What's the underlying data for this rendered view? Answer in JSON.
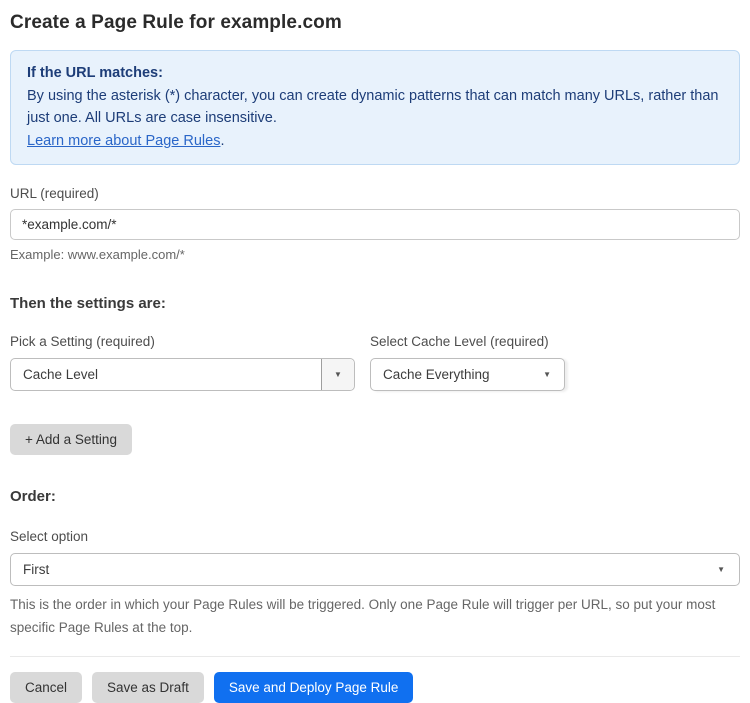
{
  "page": {
    "title": "Create a Page Rule for example.com"
  },
  "info_box": {
    "heading": "If the URL matches:",
    "body": "By using the asterisk (*) character, you can create dynamic patterns that can match many URLs, rather than just one. All URLs are case insensitive.",
    "link_label": "Learn more about Page Rules",
    "link_suffix": "."
  },
  "url_field": {
    "label": "URL (required)",
    "value": "*example.com/*",
    "helper": "Example: www.example.com/*"
  },
  "settings": {
    "heading": "Then the settings are:",
    "setting_picker": {
      "label": "Pick a Setting (required)",
      "value": "Cache Level"
    },
    "cache_level_picker": {
      "label": "Select Cache Level (required)",
      "value": "Cache Everything"
    },
    "add_setting_label": "+ Add a Setting"
  },
  "order": {
    "heading": "Order:",
    "label": "Select option",
    "value": "First",
    "helper": "This is the order in which your Page Rules will be triggered. Only one Page Rule will trigger per URL, so put your most specific Page Rules at the top."
  },
  "footer": {
    "cancel_label": "Cancel",
    "save_draft_label": "Save as Draft",
    "save_deploy_label": "Save and Deploy Page Rule"
  },
  "icons": {
    "dropdown_caret": "▼"
  },
  "colors": {
    "info_box_bg": "#e8f2fc",
    "info_box_border": "#bed9f3",
    "info_text": "#1d3d78",
    "link_blue": "#2a66c8",
    "primary_button_blue": "#1070f0",
    "gray_button_bg": "#d9d9d9"
  }
}
